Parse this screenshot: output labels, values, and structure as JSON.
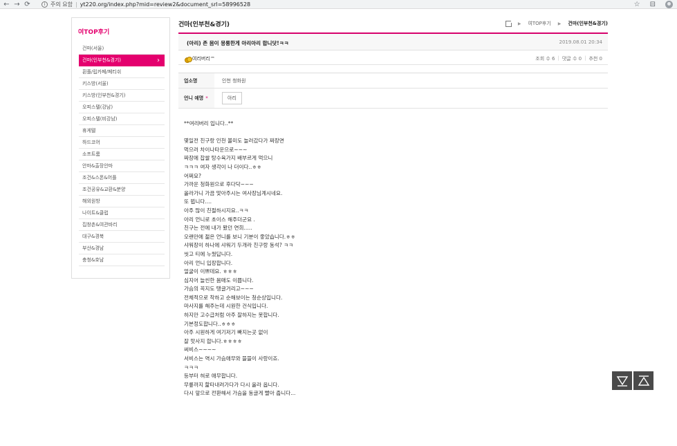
{
  "browser": {
    "security_label": "주의 요함",
    "separator": "|",
    "url": "yt220.org/index.php?mid=review2&document_srl=58996528",
    "back_icon": "←",
    "forward_icon": "→",
    "reload_icon": "⟳",
    "star_icon": "☆",
    "menu_icon": "⊟"
  },
  "sidebar": {
    "title": "여TOP후기",
    "items": [
      {
        "label": "건마(서울)"
      },
      {
        "label": "건마(인부천&경기)",
        "active": true
      },
      {
        "label": "휜플/립카페/페티쉬"
      },
      {
        "label": "키스방(서울)"
      },
      {
        "label": "키스방(인부천&경기)"
      },
      {
        "label": "오피스텔(강남)"
      },
      {
        "label": "오피스텔(비강남)"
      },
      {
        "label": "휴게텔"
      },
      {
        "label": "하드코어"
      },
      {
        "label": "소프트룸"
      },
      {
        "label": "안마&출장안마"
      },
      {
        "label": "조건&스폰&어플"
      },
      {
        "label": "조건공유&교환&분양"
      },
      {
        "label": "해외원방"
      },
      {
        "label": "나이트&클럽"
      },
      {
        "label": "집창촌&여관바리"
      },
      {
        "label": "대구&경북"
      },
      {
        "label": "부산&경남"
      },
      {
        "label": "충청&호남"
      }
    ]
  },
  "main": {
    "board_title": "건마(인부천&경기)",
    "breadcrumb": {
      "first": "여TOP후기",
      "current": "건마(인부천&경기)"
    },
    "post": {
      "title": "(아리) 존 몸이 몽롱한게 아리아리 합니닷!ㅋㅋ",
      "date": "2019.08.01 20:34",
      "author": "여리버리™",
      "views": "조회 수 6",
      "comments": "댓글 수 0",
      "likes": "추천 0"
    },
    "info": {
      "shop_label": "업소명",
      "shop_value": "인천 청화원",
      "girl_label": "언니 예명",
      "girl_required": "*",
      "girl_value": "아리"
    },
    "content_lines": [
      "**여리버리 입니다..**",
      "",
      "몇일전  친구랑 인천 볼미도 놀러갔다가  짜장면",
      "  먹으러 차이나타운으로~~~",
      "짜장에 찹쌀 탕수육가지  배부르게 먹으니",
      "ㅋㅋㅋ 여자 생각이 나 더이다..ㅎㅎ",
      "어쩌요?",
      "가까운 청화원으로  후다닥~~~",
      "올라가니 가끔 맞아주시는  여사장님계시네요.",
      "또 뵙니다....",
      "아주 많이 친절하시지요..ㅋㅋ",
      "아리 언니로 초이스 해주더군요 .",
      "친구는 전에 내가 봤던 연희.....",
      "오랜만에 젊은 언니를 보니 기분이 좋았습니다.ㅎㅎ",
      "샤워장이 하나에 샤워기 두개라 친구랑 동석? ㅋㅋ",
      "씻고 티에 누웠답니다.",
      "아리 언니 입장합니다.",
      "얼굴이 이쁘데요. ㅎㅎㅎ",
      "심지어 늘씬한 몸매도 이쁩니다.",
      "가슴의 꼭지도 탱글거리고~~~",
      "전체적으로 착하고 순해보이는 청순상입니다.",
      "마사지를 해주는데 시원한 건식입니다.",
      "하지만 고수급처럼 아주 잘하지는 못합니다.",
      "기본정도합니다..ㅎㅎㅎ",
      "아주 시원하게 여기저기 빠지는곳 없이",
      "잘 맛사지 합니다.ㅎㅎㅎㅎ",
      "써비스~~~~",
      "서비스는 역시 가슴애무와 뜰뜰이 사랑이죠.",
      "ㅋㅋㅋ",
      "등부터 혀로 애무합니다.",
      "무릎까지 핥타내려가다가 다시 올라 옵니다.",
      "다시 앞으로 전환해서 가슴을 동글게 빨아 줍니다..."
    ]
  },
  "colors": {
    "accent": "#e4006e",
    "float_button_bg": "#4a4a4a"
  },
  "icons": {
    "scroll_down": "scroll-down-icon",
    "scroll_up": "scroll-up-icon"
  }
}
